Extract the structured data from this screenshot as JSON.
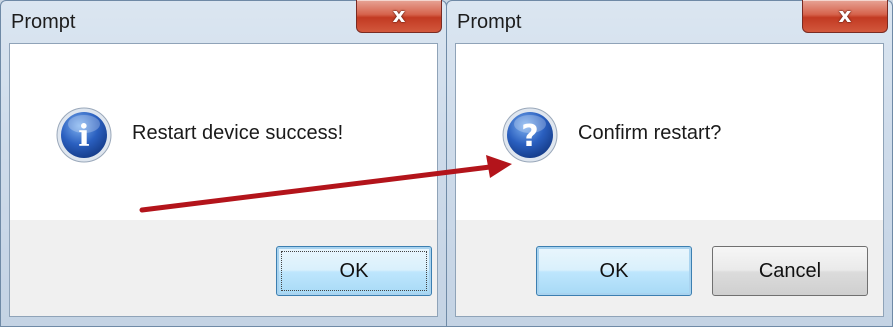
{
  "dialogs": [
    {
      "title": "Prompt",
      "close_glyph": "x",
      "icon": "info-icon",
      "icon_glyph": "i",
      "message": "Restart device success!",
      "buttons": {
        "ok": "OK"
      }
    },
    {
      "title": "Prompt",
      "close_glyph": "x",
      "icon": "question-icon",
      "icon_glyph": "?",
      "message": "Confirm restart?",
      "buttons": {
        "ok": "OK",
        "cancel": "Cancel"
      }
    }
  ],
  "colors": {
    "arrow": "#b3141b",
    "icon_blue": "#1e4fa8",
    "close_red": "#c23a22"
  }
}
